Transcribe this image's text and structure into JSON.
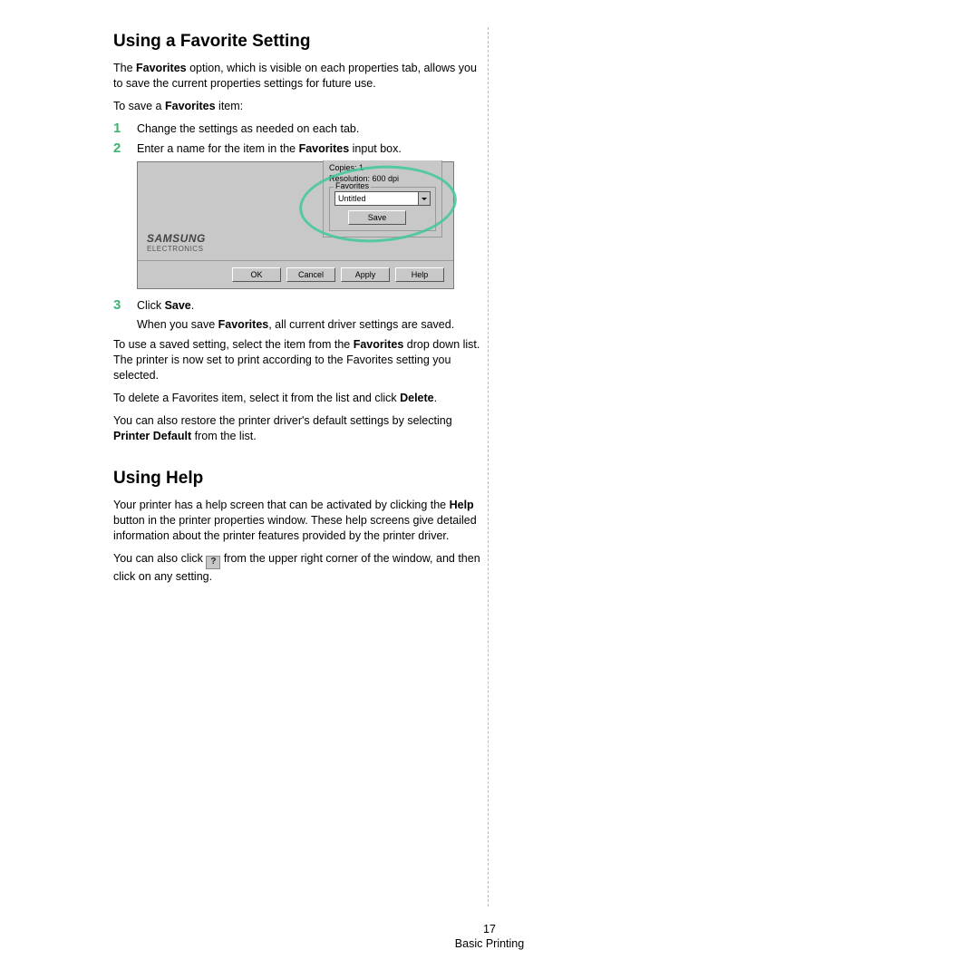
{
  "section1": {
    "heading": "Using a Favorite Setting",
    "intro_a": "The ",
    "intro_b": "Favorites",
    "intro_c": " option, which is visible on each properties tab, allows you to save the current properties settings for future use.",
    "save_a": "To save a ",
    "save_b": "Favorites",
    "save_c": " item:",
    "step1_num": "1",
    "step1": "Change the settings as needed on each tab.",
    "step2_num": "2",
    "step2_a": "Enter a name for the item in the ",
    "step2_b": "Favorites",
    "step2_c": " input box.",
    "step3_num": "3",
    "step3_a": "Click ",
    "step3_b": "Save",
    "step3_c": ".",
    "step3_sub_a": "When you save ",
    "step3_sub_b": "Favorites",
    "step3_sub_c": ", all current driver settings are saved.",
    "use_a": "To use a saved setting, select the item from the ",
    "use_b": "Favorites",
    "use_c": " drop down list. The printer is now set to print according to the Favorites setting you selected.",
    "del_a": "To delete a Favorites item, select it from the list and click ",
    "del_b": "Delete",
    "del_c": ".",
    "restore_a": "You can also restore the printer driver's default settings by selecting ",
    "restore_b": "Printer Default",
    "restore_c": " from the list."
  },
  "dialog": {
    "copies": "Copies: 1",
    "resolution": "Resolution: 600 dpi",
    "fav_legend": "Favorites",
    "combo_value": "Untitled",
    "save": "Save",
    "brand": "SAMSUNG",
    "brand_sub": "ELECTRONICS",
    "ok": "OK",
    "cancel": "Cancel",
    "apply": "Apply",
    "help": "Help"
  },
  "section2": {
    "heading": "Using Help",
    "p1_a": "Your printer has a help screen that can be activated by clicking the ",
    "p1_b": "Help",
    "p1_c": " button in the printer properties window. These help screens give detailed information about the printer features provided by the printer driver.",
    "p2_a": "You can also click ",
    "p2_icon": "?",
    "p2_b": " from the upper right corner of the window, and then click on any setting."
  },
  "footer": {
    "page": "17",
    "label": "Basic Printing"
  }
}
